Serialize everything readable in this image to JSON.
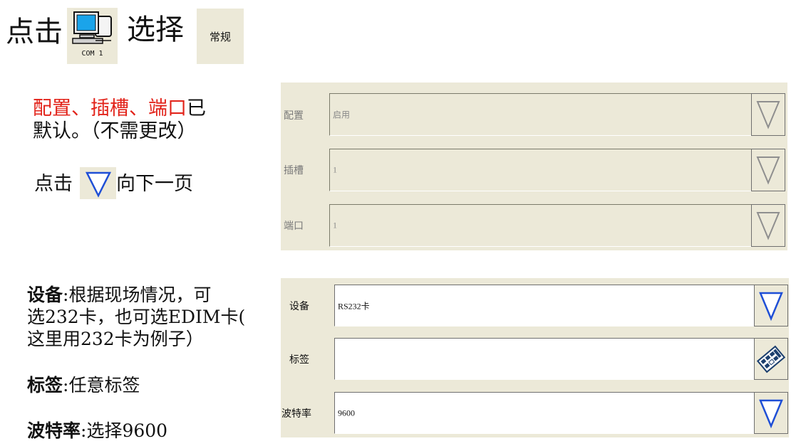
{
  "header": {
    "click_text": "点击",
    "com_label": "COM 1",
    "select_text": "选择",
    "tab_label": "常规"
  },
  "instructions": {
    "line1_red": "配置、插槽、端口",
    "line1_tail": "已",
    "line2": "默认。（不需更改）",
    "click_text": "点击",
    "next_page": "向下一页"
  },
  "notes": {
    "device_key": "设备",
    "device_desc_l1": ":根据现场情况，可",
    "device_desc_l2": "选232卡，也可选EDIM卡(",
    "device_desc_l3": "这里用232卡为例子）",
    "tag_key": "标签",
    "tag_desc": ":任意标签",
    "baud_key": "波特率",
    "baud_desc": ":选择9600"
  },
  "panel_general": {
    "rows": [
      {
        "label": "配置",
        "value": "启用"
      },
      {
        "label": "插槽",
        "value": "1"
      },
      {
        "label": "端口",
        "value": "1"
      }
    ]
  },
  "panel_device": {
    "rows": [
      {
        "label": "设备",
        "value": "RS232卡"
      },
      {
        "label": "标签",
        "value": ""
      },
      {
        "label": "波特率",
        "value": "9600"
      }
    ]
  },
  "icons": {
    "computer": "computer-network-icon",
    "dropdown": "triangle-down-icon",
    "keyboard": "keyboard-icon"
  },
  "colors": {
    "panel_bg": "#ece9d8",
    "highlight_red": "#e2231a",
    "triangle_blue": "#1f4fd6"
  }
}
